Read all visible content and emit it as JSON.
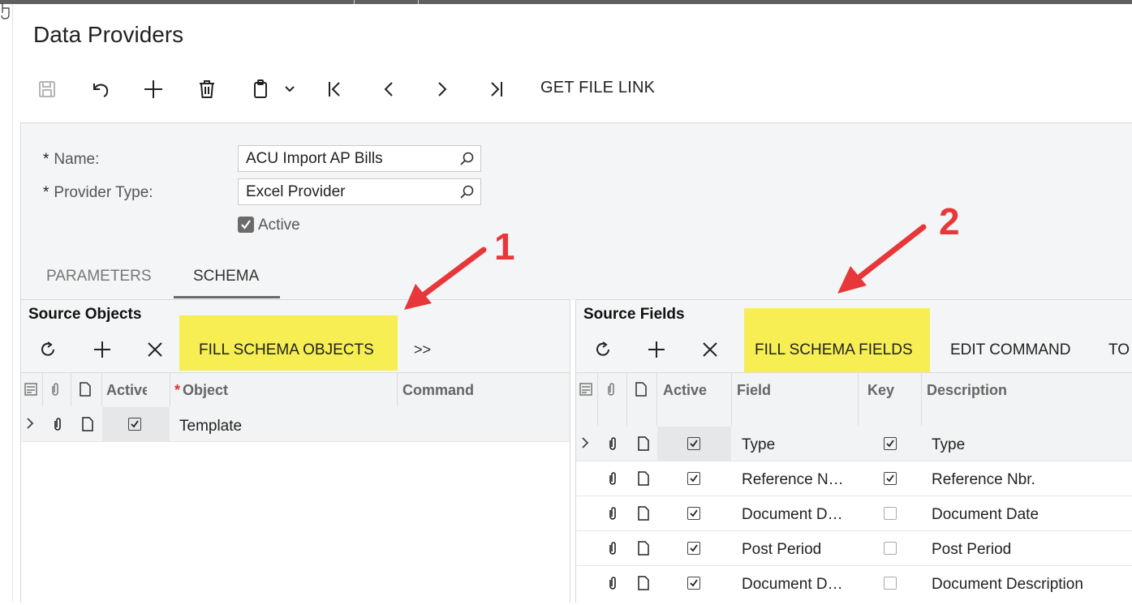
{
  "page": {
    "title": "Data Providers"
  },
  "toolbar": {
    "save": "save-icon",
    "undo": "undo-icon",
    "add": "plus-icon",
    "delete": "trash-icon",
    "clipboard": "clipboard-icon",
    "first": "first-record-icon",
    "prev": "previous-record-icon",
    "next": "next-record-icon",
    "last": "last-record-icon",
    "get_file_link": "GET FILE LINK"
  },
  "form": {
    "name_label": "Name:",
    "name_value": "ACU Import AP Bills",
    "provider_type_label": "Provider Type:",
    "provider_type_value": "Excel Provider",
    "active_label": "Active",
    "required_mark": "*"
  },
  "tabs": [
    {
      "label": "PARAMETERS"
    },
    {
      "label": "SCHEMA"
    }
  ],
  "source_objects": {
    "title": "Source Objects",
    "fill_button": "FILL SCHEMA OBJECTS",
    "more_icon": ">>",
    "columns": [
      "Active",
      "Object",
      "Command"
    ],
    "required_mark": "*",
    "rows": [
      {
        "active": true,
        "object": "Template",
        "command": ""
      }
    ]
  },
  "source_fields": {
    "title": "Source Fields",
    "fill_button": "FILL SCHEMA FIELDS",
    "edit_command": "EDIT COMMAND",
    "truncated_button": "TO",
    "columns": [
      "Active",
      "Field",
      "Key",
      "Description"
    ],
    "rows": [
      {
        "active": true,
        "field": "Type",
        "key": true,
        "description": "Type"
      },
      {
        "active": true,
        "field": "Reference N…",
        "key": true,
        "description": "Reference Nbr."
      },
      {
        "active": true,
        "field": "Document D…",
        "key": false,
        "description": "Document Date"
      },
      {
        "active": true,
        "field": "Post Period",
        "key": false,
        "description": "Post Period"
      },
      {
        "active": true,
        "field": "Document D…",
        "key": false,
        "description": "Document Description"
      }
    ]
  },
  "annotations": {
    "marker_1": "1",
    "marker_2": "2",
    "arrow_color": "#e8373b",
    "highlight_color": "#f6ee52"
  }
}
